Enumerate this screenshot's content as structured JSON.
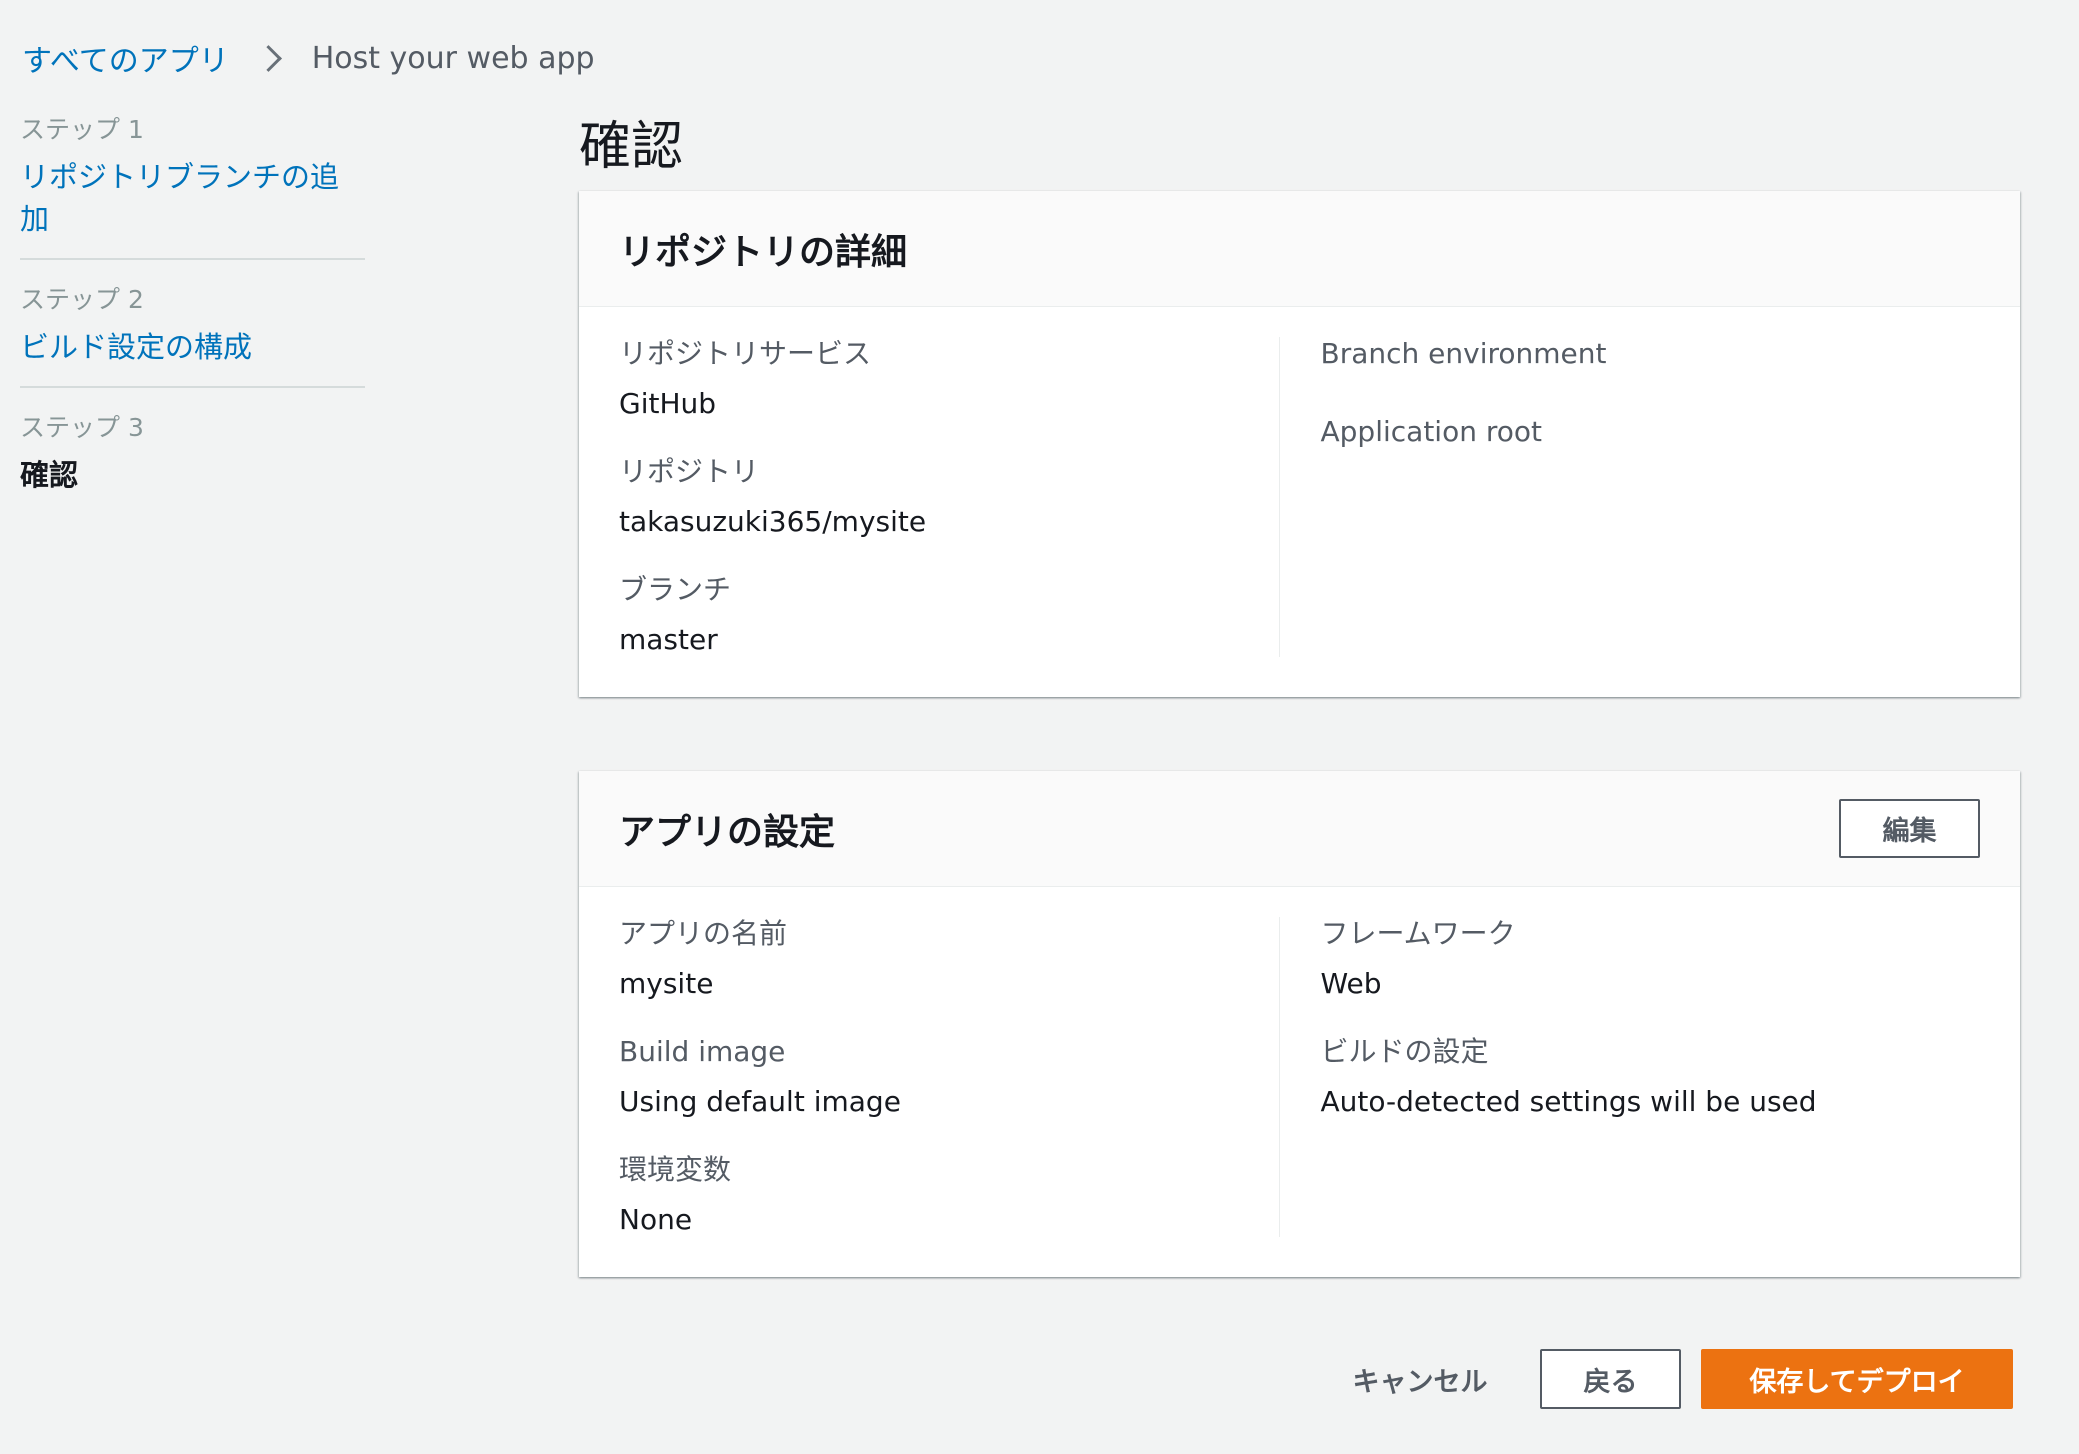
{
  "breadcrumb": {
    "root": "すべてのアプリ",
    "current": "Host your web app"
  },
  "steps": [
    {
      "label": "ステップ 1",
      "title": "リポジトリブランチの追加"
    },
    {
      "label": "ステップ 2",
      "title": "ビルド設定の構成"
    },
    {
      "label": "ステップ 3",
      "title": "確認"
    }
  ],
  "page": {
    "title": "確認"
  },
  "repo_panel": {
    "title": "リポジトリの詳細",
    "left": [
      {
        "label": "リポジトリサービス",
        "value": "GitHub"
      },
      {
        "label": "リポジトリ",
        "value": "takasuzuki365/mysite"
      },
      {
        "label": "ブランチ",
        "value": "master"
      }
    ],
    "right": [
      {
        "label": "Branch environment",
        "value": ""
      },
      {
        "label": "Application root",
        "value": ""
      }
    ]
  },
  "app_panel": {
    "title": "アプリの設定",
    "edit_label": "編集",
    "left": [
      {
        "label": "アプリの名前",
        "value": "mysite"
      },
      {
        "label": "Build image",
        "value": "Using default image"
      },
      {
        "label": "環境変数",
        "value": "None"
      }
    ],
    "right": [
      {
        "label": "フレームワーク",
        "value": "Web"
      },
      {
        "label": "ビルドの設定",
        "value": "Auto-detected settings will be used"
      }
    ]
  },
  "actions": {
    "cancel": "キャンセル",
    "back": "戻る",
    "deploy": "保存してデプロイ"
  },
  "colors": {
    "link": "#0073bb",
    "primary": "#ec7211",
    "background": "#f2f3f3"
  }
}
